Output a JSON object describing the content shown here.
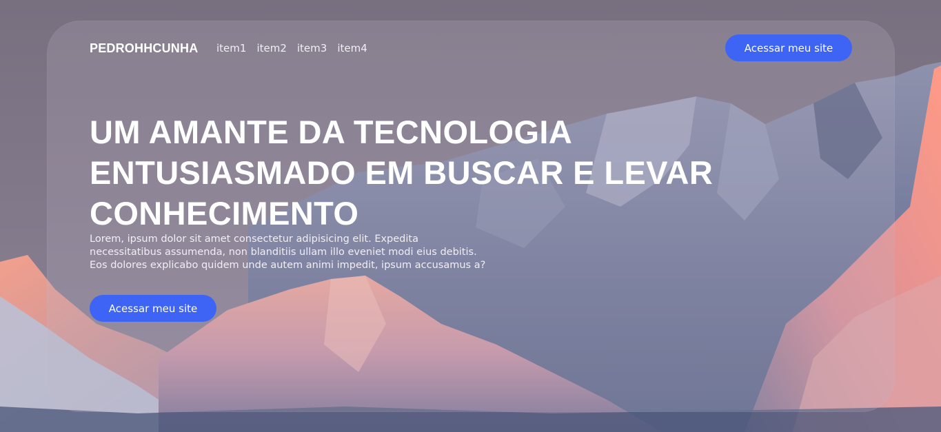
{
  "nav": {
    "brand": "PEDROHHCUNHA",
    "items": [
      "item1",
      "item2",
      "item3",
      "item4"
    ],
    "cta_label": "Acessar meu site"
  },
  "hero": {
    "title": "UM AMANTE DA TECNOLOGIA ENTUSIASMADO EM BUSCAR E LEVAR CONHECIMENTO",
    "text": "Lorem, ipsum dolor sit amet consectetur adipisicing elit. Expedita necessitatibus assumenda, non blanditiis ullam illo eveniet modi eius debitis. Eos dolores explicabo quidem unde autem animi impedit, ipsum accusamus a?",
    "cta_label": "Acessar meu site"
  },
  "colors": {
    "accent": "#3d64f5",
    "sky": "#6e6878",
    "mountain_shadow": "#5d6584",
    "alpenglow": "#e8907f"
  }
}
